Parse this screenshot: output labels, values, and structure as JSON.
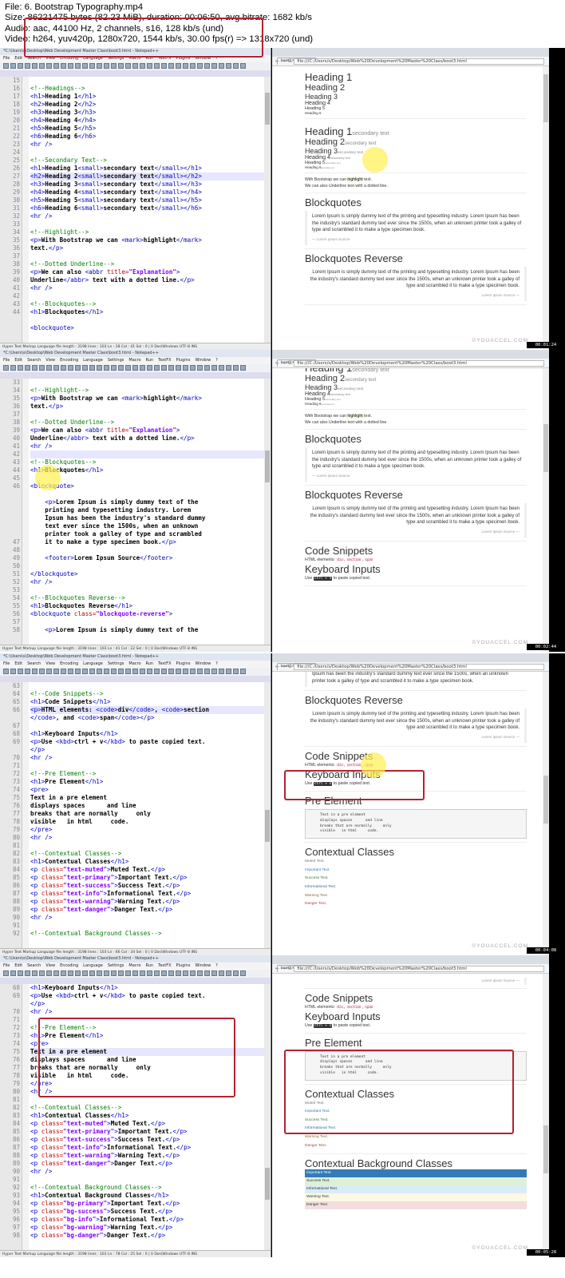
{
  "info": {
    "line1": "File: 6. Bootstrap Typography.mp4",
    "line2": "Size: 86221475 bytes (82.23 MiB), duration: 00:06:50, avg.bitrate: 1682 kb/s",
    "line3": "Audio: aac, 44100 Hz, 2 channels, s16, 128 kb/s (und)",
    "line4": "Video: h264, yuv420p, 1280x720, 1544 kb/s, 30.00 fps(r) => 1318x720 (und)"
  },
  "editor": {
    "title": "*C:\\Users\\s\\Desktop\\Web Development Master Class\\boot3.html - Notepad++",
    "menu": [
      "File",
      "Edit",
      "Search",
      "View",
      "Encoding",
      "Language",
      "Settings",
      "Macro",
      "Run",
      "TextFX",
      "Plugins",
      "Window",
      "?"
    ],
    "tab": "boot3.html",
    "status": "Hyper Text Markup Language file    length : 3198    lines : 103        Dos\\Windows    UTF-8    INS"
  },
  "browser": {
    "tab": "boot3.html",
    "url": "file:///C:/Users/s/Desktop/Web%20Development%20Master%20Class/boot3.html"
  },
  "watermark": "©YOUACCEL.COM",
  "timestamps": [
    "00:01:24",
    "00:02:44",
    "00:04:08",
    "00:05:28"
  ],
  "page": {
    "headings": [
      "Heading 1",
      "Heading 2",
      "Heading 3",
      "Heading 4",
      "Heading 5",
      "Heading 6"
    ],
    "secondary": "secondary text",
    "highlight_pre": "With Bootstrap we can ",
    "highlight_word": "highlight",
    "highlight_post": " text.",
    "abbr_line": "We can also Underline text with a dotted line.",
    "blockquotes_title": "Blockquotes",
    "blockquotes_reverse_title": "Blockquotes Reverse",
    "lorem": "Lorem Ipsum is simply dummy text of the printing and typesetting industry. Lorem Ipsum has been the industry's standard dummy text ever since the 1500s, when an unknown printer took a galley of type and scrambled it to make a type specimen book.",
    "source": "— Lorem Ipsum Source",
    "source_rev": "Lorem Ipsum Source —",
    "code_title": "Code Snippets",
    "code_pre": "HTML elements: ",
    "code_items": [
      "div",
      "section",
      "span"
    ],
    "kbd_title": "Keyboard Inputs",
    "kbd_pre": "Use ",
    "kbd_key": "ctrl + v",
    "kbd_post": " to paste copied text.",
    "pre_title": "Pre Element",
    "pre_text": "Text in a pre element\ndisplays spaces      and line\nbreaks that are normally     only\nvisible   in html     code.",
    "ctx_title": "Contextual Classes",
    "ctx_items": [
      "Muted Text.",
      "Important Text.",
      "Success Text.",
      "Informational Text.",
      "Warning Text.",
      "Danger Text."
    ],
    "ctx_colors": [
      "#777777",
      "#337ab7",
      "#3c763d",
      "#31708f",
      "#8a6d3b",
      "#a94442"
    ],
    "bg_title": "Contextual Background Classes",
    "bg_items": [
      "Important Text.",
      "Success Text.",
      "Informational Text.",
      "Warning Text.",
      "Danger Text."
    ],
    "bg_colors": [
      "#337ab7",
      "#dff0d8",
      "#d9edf7",
      "#fcf8e3",
      "#f2dede"
    ]
  },
  "frames": [
    {
      "start": 16,
      "hl": 12,
      "status": "Ln : 28   Col : 41   Sel : 0 | 0",
      "lines": [
        "",
        "<!--Headings-->",
        "<h1>Heading 1</h1>",
        "<h2>Heading 2</h2>",
        "<h3>Heading 3</h3>",
        "<h4>Heading 4</h4>",
        "<h5>Heading 5</h5>",
        "<h6>Heading 6</h6>",
        "<hr />",
        "",
        "<!--Secondary Text-->",
        "<h1>Heading 1<small>secondary text</small></h1>",
        "<h2>Heading 2<small>secondary text</small></h2>",
        "<h3>Heading 3<small>secondary text</small></h3>",
        "<h4>Heading 4<small>secondary text</small></h4>",
        "<h5>Heading 5<small>secondary text</small></h5>",
        "<h6>Heading 6<small>secondary text</small></h6>",
        "<hr />",
        "",
        "<!--Highlight-->",
        "<p>With Bootstrap we can <mark>highlight</mark>",
        "text.</p>",
        "",
        "<!--Dotted Underline-->",
        "<p>We can also <abbr title=\"Explanation\">",
        "Underline</abbr> text with a dotted line.</p>",
        "<hr />",
        "",
        "<!--Blockquotes-->",
        "<h1>Blockquotes</h1>",
        "",
        "<blockquote>",
        ""
      ],
      "nums": [
        "15",
        "16",
        "17",
        "18",
        "19",
        "20",
        "21",
        "22",
        "23",
        "24",
        "25",
        "26",
        "27",
        "28",
        "29",
        "30",
        "31",
        "32",
        "33",
        "34",
        "35",
        "36",
        "37",
        "38",
        "39",
        "40",
        "41",
        "42",
        "43",
        "44"
      ]
    },
    {
      "start": 33,
      "hl": 9,
      "status": "Ln : 41   Col : 22   Sel : 0 | 0",
      "lines": [
        "",
        "<!--Highlight-->",
        "<p>With Bootstrap we can <mark>highlight</mark>",
        "text.</p>",
        "",
        "<!--Dotted Underline-->",
        "<p>We can also <abbr title=\"Explanation\">",
        "Underline</abbr> text with a dotted line.</p>",
        "<hr />",
        "",
        "<!--Blockquotes-->",
        "<h1>Blockquotes</h1>",
        "",
        "<blockquote>",
        "",
        "    <p>Lorem Ipsum is simply dummy text of the",
        "    printing and typesetting industry. Lorem",
        "    Ipsum has been the industry's standard dummy",
        "    text ever since the 1500s, when an unknown",
        "    printer took a galley of type and scrambled",
        "    it to make a type specimen book.</p>",
        "",
        "    <footer>Lorem Ipsum Source</footer>",
        "",
        "</blockquote>",
        "<hr />",
        "",
        "<!--Blockquotes Reverse-->",
        "<h1>Blockquotes Reverse</h1>",
        "<blockquote class=\"blockquote-reverse\">",
        "",
        "    <p>Lorem Ipsum is simply dummy text of the"
      ],
      "nums": [
        "33",
        "34",
        "35",
        "36",
        "37",
        "38",
        "39",
        "40",
        "41",
        "42",
        "43",
        "44",
        "45",
        "46",
        "",
        "",
        "",
        "",
        "",
        "",
        "47",
        "48",
        "49",
        "50",
        "51",
        "52",
        "53",
        "54",
        "55",
        "56",
        "57",
        "58"
      ]
    },
    {
      "start": 63,
      "hl": 3,
      "status": "Ln : 66   Col : 34   Sel : 0 | 0",
      "lines": [
        "",
        "<!--Code Snippets-->",
        "<h1>Code Snippets</h1>",
        "<p>HTML elements: <code>div</code>, <code>section",
        "</code>, and <code>span</code></p>",
        "",
        "<h1>Keyboard Inputs</h1>",
        "<p>Use <kbd>ctrl + v</kbd> to paste copied text.",
        "</p>",
        "<hr />",
        "",
        "<!--Pre Element-->",
        "<h1>Pre Element</h1>",
        "<pre>",
        "Text in a pre element",
        "displays spaces      and line",
        "breaks that are normally     only",
        "visible   in html     code.",
        "</pre>",
        "<hr />",
        "",
        "<!--Contextual Classes-->",
        "<h1>Contextual Classes</h1>",
        "<p class=\"text-muted\">Muted Text.</p>",
        "<p class=\"text-primary\">Important Text.</p>",
        "<p class=\"text-success\">Success Text.</p>",
        "<p class=\"text-info\">Informational Text.</p>",
        "<p class=\"text-warning\">Warning Text.</p>",
        "<p class=\"text-danger\">Danger Text.</p>",
        "<hr />",
        "",
        "<!--Contextual Background Classes-->"
      ],
      "nums": [
        "63",
        "64",
        "65",
        "66",
        "",
        "67",
        "68",
        "69",
        "",
        "70",
        "71",
        "72",
        "73",
        "74",
        "75",
        "76",
        "77",
        "78",
        "79",
        "80",
        "81",
        "82",
        "83",
        "84",
        "85",
        "86",
        "87",
        "88",
        "89",
        "90",
        "91",
        "92"
      ]
    },
    {
      "start": 68,
      "hl": 8,
      "status": "Ln : 78   Col : 25   Sel : 0 | 0",
      "lines": [
        "<h1>Keyboard Inputs</h1>",
        "<p>Use <kbd>ctrl + v</kbd> to paste copied text.",
        "</p>",
        "<hr />",
        "",
        "<!--Pre Element-->",
        "<h1>Pre Element</h1>",
        "<pre>",
        "Text in a pre element",
        "displays spaces      and line",
        "breaks that are normally     only",
        "visible   in html     code.",
        "</pre>",
        "<hr />",
        "",
        "<!--Contextual Classes-->",
        "<h1>Contextual Classes</h1>",
        "<p class=\"text-muted\">Muted Text.</p>",
        "<p class=\"text-primary\">Important Text.</p>",
        "<p class=\"text-success\">Success Text.</p>",
        "<p class=\"text-info\">Informational Text.</p>",
        "<p class=\"text-warning\">Warning Text.</p>",
        "<p class=\"text-danger\">Danger Text.</p>",
        "<hr />",
        "",
        "<!--Contextual Background Classes-->",
        "<h1>Contextual Background Classes</h1>",
        "<p class=\"bg-primary\">Important Text.</p>",
        "<p class=\"bg-success\">Success Text.</p>",
        "<p class=\"bg-info\">Informational Text.</p>",
        "<p class=\"bg-warning\">Warning Text.</p>",
        "<p class=\"bg-danger\">Danger Text.</p>"
      ],
      "nums": [
        "68",
        "69",
        "",
        "70",
        "71",
        "72",
        "73",
        "74",
        "75",
        "76",
        "77",
        "78",
        "79",
        "80",
        "81",
        "82",
        "83",
        "84",
        "85",
        "86",
        "87",
        "88",
        "89",
        "90",
        "91",
        "92",
        "93",
        "94",
        "95",
        "96",
        "97",
        "98"
      ]
    }
  ]
}
